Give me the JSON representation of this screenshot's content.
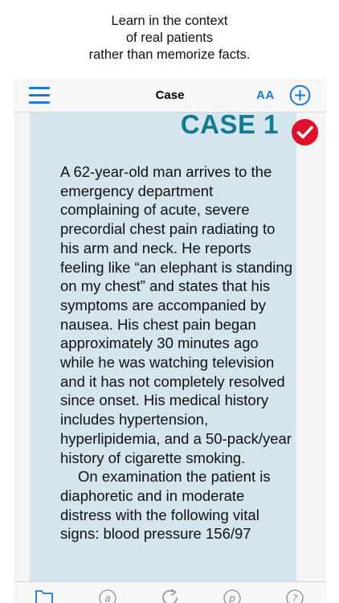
{
  "promo": {
    "lines": [
      "Learn in the context",
      "of real patients",
      "rather than memorize facts."
    ]
  },
  "navbar": {
    "title": "Case",
    "font_size_label": "AA",
    "icons": {
      "menu": "hamburger-menu-icon",
      "add": "plus-circle-icon"
    }
  },
  "case": {
    "title": "CASE 1",
    "status_icon": "checkmark-badge-icon",
    "paragraphs": [
      "A 62-year-old man arrives to the emergency department complaining of acute, severe precordial chest pain radiating to his arm and neck. He reports feeling like “an elephant is standing on my chest” and states that his symptoms are accompanied by nausea. His chest pain began approximately 30 minutes ago while he was watching television and it has not completely resolved since onset. His medical history includes hypertension, hyperlipidemia, and a 50-pack/year history of cigarette smoking.",
      "On examination the patient is diaphoretic and in moderate distress with the following vital signs: blood pressure 156/97"
    ]
  },
  "tabbar": {
    "tabs": [
      {
        "icon": "folder-icon"
      },
      {
        "icon": "at-sign-icon"
      },
      {
        "icon": "refresh-icon"
      },
      {
        "icon": "p-circle-icon"
      },
      {
        "icon": "help-icon"
      }
    ]
  },
  "colors": {
    "accent": "#1a7ad8",
    "case_title": "#137a8f",
    "content_background": "#d4e5ee",
    "badge": "#e0102a"
  }
}
